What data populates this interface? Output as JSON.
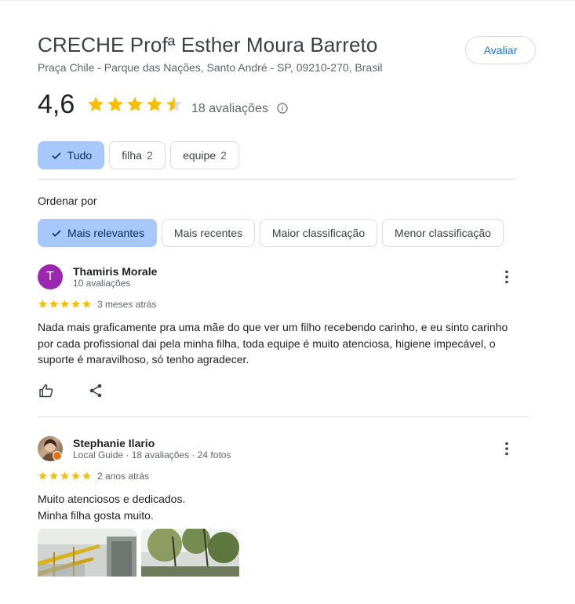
{
  "place": {
    "title": "CRECHE Profª Esther Moura Barreto",
    "address": "Praça Chile - Parque das Nações, Santo André - SP, 09210-270, Brasil",
    "rate_button": "Avaliar"
  },
  "summary": {
    "rating": "4,6",
    "rating_value": 4.6,
    "review_count": "18 avaliações",
    "star_color": "#fbbc04"
  },
  "filters": {
    "chips": [
      {
        "label": "Tudo",
        "count": "",
        "selected": true
      },
      {
        "label": "filha",
        "count": "2",
        "selected": false
      },
      {
        "label": "equipe",
        "count": "2",
        "selected": false
      }
    ]
  },
  "sort": {
    "label": "Ordenar por",
    "options": [
      {
        "label": "Mais relevantes",
        "selected": true
      },
      {
        "label": "Mais recentes",
        "selected": false
      },
      {
        "label": "Maior classificação",
        "selected": false
      },
      {
        "label": "Menor classificação",
        "selected": false
      }
    ]
  },
  "reviews": [
    {
      "avatar_initial": "T",
      "avatar_color": "#9c27b0",
      "author": "Thamiris Morale",
      "meta": "10 avaliações",
      "stars": 5,
      "date": "3 meses atrás",
      "text_lines": [
        "Nada mais graficamente pra uma mãe do que ver um filho recebendo carinho, e eu sinto carinho",
        "por cada profissional dai pela minha filha, toda equipe é muito atenciosa, higiene impecável, o",
        "suporte é maravilhoso, só tenho agradecer."
      ]
    },
    {
      "avatar_initial": "",
      "author": "Stephanie Ilario",
      "meta": "Local Guide · 18 avaliações · 24 fotos",
      "stars": 5,
      "date": "2 anos atrás",
      "text_lines": [
        "Muito atenciosos e dedicados.",
        "Minha filha gosta muito."
      ]
    }
  ]
}
